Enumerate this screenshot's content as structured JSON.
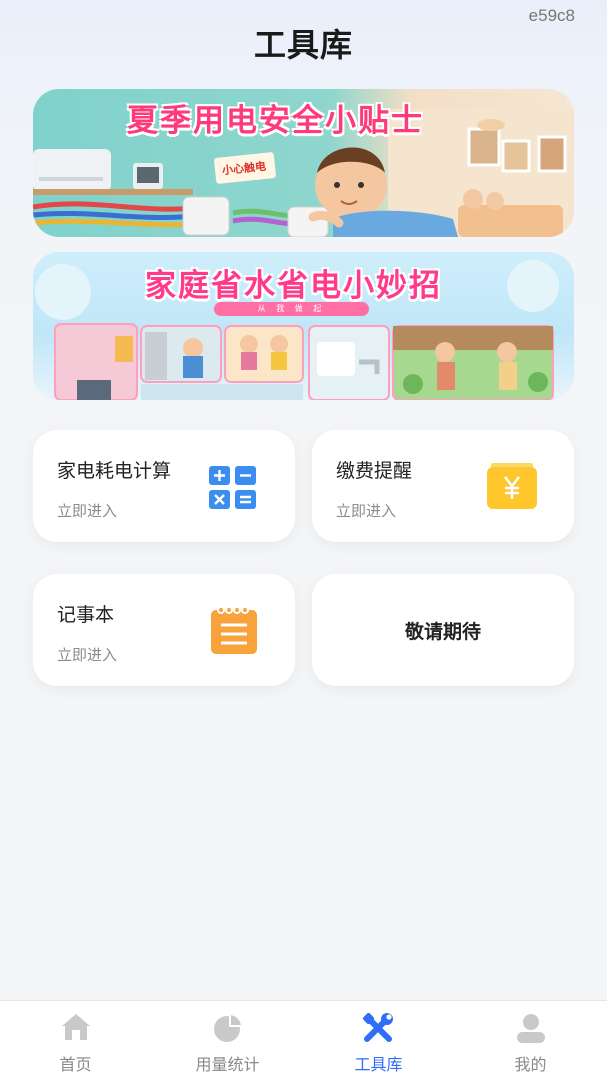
{
  "watermark": "e59c8",
  "header": {
    "title": "工具库"
  },
  "banners": [
    {
      "title": "夏季用电安全小贴士",
      "sticker": "小心触电"
    },
    {
      "title": "家庭省水省电小妙招",
      "subtitle": "从 我 做 起"
    }
  ],
  "cards": [
    {
      "title": "家电耗电计算",
      "sub": "立即进入",
      "icon": "calculator-icon"
    },
    {
      "title": "缴费提醒",
      "sub": "立即进入",
      "icon": "yen-wallet-icon"
    },
    {
      "title": "记事本",
      "sub": "立即进入",
      "icon": "notepad-icon"
    },
    {
      "title": "敬请期待"
    }
  ],
  "tabbar": {
    "items": [
      {
        "label": "首页",
        "icon": "home-icon"
      },
      {
        "label": "用量统计",
        "icon": "pie-chart-icon"
      },
      {
        "label": "工具库",
        "icon": "tools-icon",
        "active": true
      },
      {
        "label": "我的",
        "icon": "user-icon"
      }
    ]
  },
  "colors": {
    "accent": "#2f6ef6",
    "calculator": "#3b8df0",
    "wallet": "#ffc72c",
    "notepad": "#f7a23a"
  }
}
